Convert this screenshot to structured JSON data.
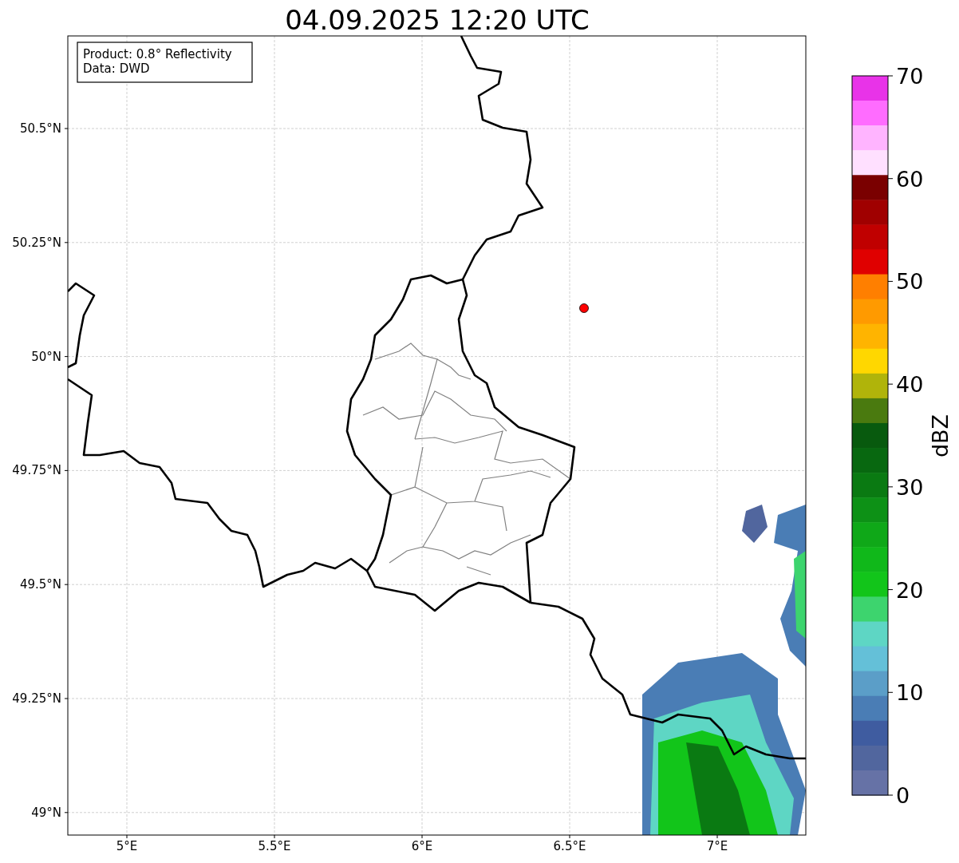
{
  "title": "04.09.2025 12:20 UTC",
  "info_box": {
    "lines": [
      "Product: 0.8° Reflectivity",
      "Data: DWD"
    ]
  },
  "map": {
    "y_ticks": [
      "50.5°N",
      "50.25°N",
      "50°N",
      "49.75°N",
      "49.5°N",
      "49.25°N",
      "49°N"
    ],
    "x_ticks": [
      "5°E",
      "5.5°E",
      "6°E",
      "6.5°E",
      "7°E"
    ]
  },
  "colorbar": {
    "label": "dBZ",
    "ticks": [
      "70",
      "60",
      "50",
      "40",
      "30",
      "20",
      "10",
      "0"
    ],
    "bins": [
      {
        "color": "#e833e8"
      },
      {
        "color": "#ff6cff"
      },
      {
        "color": "#ffb4ff"
      },
      {
        "color": "#ffe0ff"
      },
      {
        "color": "#7a0000"
      },
      {
        "color": "#a00000"
      },
      {
        "color": "#c00000"
      },
      {
        "color": "#e00000"
      },
      {
        "color": "#ff7f00"
      },
      {
        "color": "#ff9a00"
      },
      {
        "color": "#ffb400"
      },
      {
        "color": "#ffd700"
      },
      {
        "color": "#b0b40a"
      },
      {
        "color": "#4a7a0f"
      },
      {
        "color": "#085a0e"
      },
      {
        "color": "#086810"
      },
      {
        "color": "#0a7a12"
      },
      {
        "color": "#0d9116"
      },
      {
        "color": "#0fa818"
      },
      {
        "color": "#10b81a"
      },
      {
        "color": "#12c51a"
      },
      {
        "color": "#3dd46e"
      },
      {
        "color": "#5ed6c4"
      },
      {
        "color": "#64c0d8"
      },
      {
        "color": "#5b9ec8"
      },
      {
        "color": "#4a7db5"
      },
      {
        "color": "#3f5ca0"
      },
      {
        "color": "#51669e"
      },
      {
        "color": "#6672a6"
      }
    ]
  }
}
